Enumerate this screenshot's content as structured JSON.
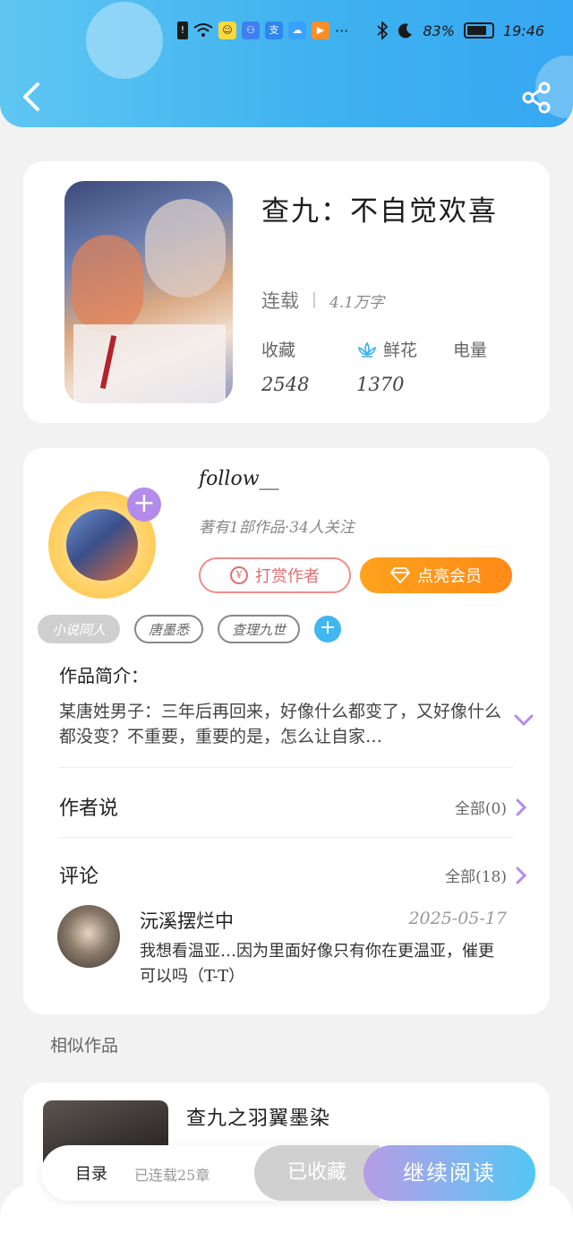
{
  "status_bar": {
    "battery": "83%",
    "battery_level": 0.83,
    "time": "19:46",
    "more": "···"
  },
  "header": {
    "back_icon": "chevron-left-icon",
    "share_icon": "share-icon"
  },
  "book": {
    "title": "查九：不自觉欢喜",
    "status": "连载",
    "words": "4.1万字",
    "stats": [
      {
        "label": "收藏",
        "value": "2548"
      },
      {
        "label": "鲜花",
        "value": "1370",
        "icon": "flower-icon"
      },
      {
        "label": "电量",
        "value": ""
      }
    ]
  },
  "author": {
    "name": "follow__",
    "stats": "著有1部作品·34人关注",
    "tip_button": "打赏作者",
    "vip_button": "点亮会员"
  },
  "tags": [
    "小说同人",
    "唐墨悉",
    "查理九世"
  ],
  "intro": {
    "title": "作品简介：",
    "text": "某唐姓男子：三年后再回来，好像什么都变了，又好像什么都没变？不重要，重要的是，怎么让自家…"
  },
  "author_says": {
    "title": "作者说",
    "more": "全部(0)"
  },
  "comments": {
    "title": "评论",
    "more": "全部(18)",
    "items": [
      {
        "user": "沅溪摆烂中",
        "date": "2025-05-17",
        "text": "我想看温亚…因为里面好像只有你在更温亚，催更可以吗（T-T）"
      }
    ]
  },
  "similar": {
    "title": "相似作品",
    "items": [
      {
        "name": "查九之羽翼墨染"
      }
    ]
  },
  "reader_bar": {
    "toc_label": "目录",
    "toc_sub": "已连载25章",
    "favorited": "已收藏",
    "continue": "继续阅读"
  },
  "colors": {
    "header_gradient_start": "#5fc6f2",
    "header_gradient_end": "#36a7f2",
    "vip_orange": "#ff8a17",
    "tip_red": "#e26f6f",
    "accent_purple": "#b38bea",
    "accent_blue": "#42b6ef"
  }
}
